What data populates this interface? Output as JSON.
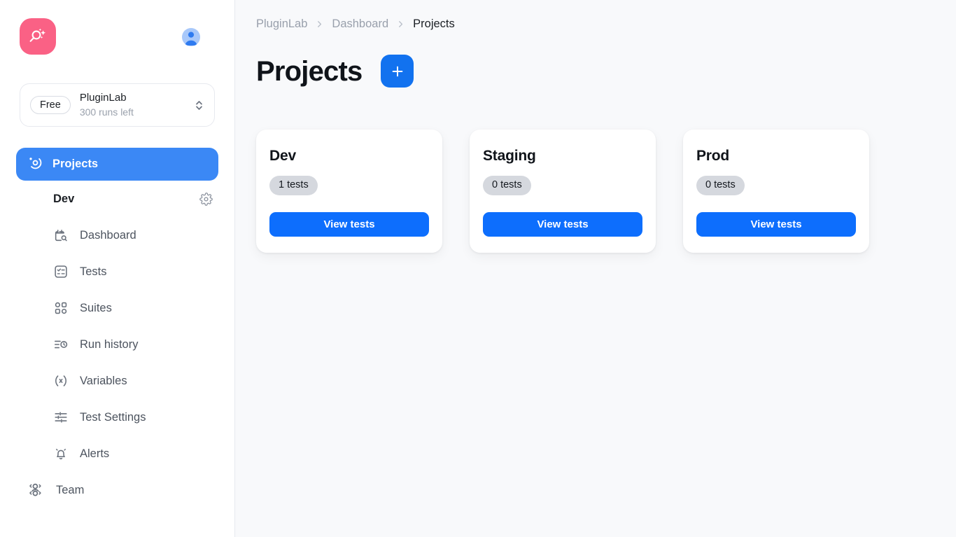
{
  "sidebar": {
    "logo_icon": "magnifier-sparkle-logo",
    "logo_color": "#fa6185",
    "avatar_icon": "user-avatar-icon",
    "workspace": {
      "plan_label": "Free",
      "name": "PluginLab",
      "runs_left": "300 runs left",
      "chevron_icon": "chevron-up-down-icon"
    },
    "primary_nav": {
      "label": "Projects",
      "icon": "orbit-icon",
      "active_color": "#3b88f5"
    },
    "project": {
      "name": "Dev",
      "settings_icon": "gear-icon"
    },
    "items": [
      {
        "label": "Dashboard",
        "icon": "calendar-search-icon"
      },
      {
        "label": "Tests",
        "icon": "checklist-square-icon"
      },
      {
        "label": "Suites",
        "icon": "grid-shapes-icon"
      },
      {
        "label": "Run history",
        "icon": "list-clock-icon"
      },
      {
        "label": "Variables",
        "icon": "variable-x-icon"
      },
      {
        "label": "Test Settings",
        "icon": "sliders-icon"
      },
      {
        "label": "Alerts",
        "icon": "bell-ring-icon"
      }
    ],
    "team": {
      "label": "Team",
      "icon": "users-group-icon"
    }
  },
  "main": {
    "breadcrumb": [
      {
        "label": "PluginLab",
        "current": false
      },
      {
        "label": "Dashboard",
        "current": false
      },
      {
        "label": "Projects",
        "current": true
      }
    ],
    "breadcrumb_separator_icon": "chevron-right-icon",
    "page_title": "Projects",
    "add_button": {
      "icon": "plus-icon",
      "color": "#1272ef"
    },
    "cards": [
      {
        "title": "Dev",
        "badge": "1 tests",
        "button_label": "View tests"
      },
      {
        "title": "Staging",
        "badge": "0 tests",
        "button_label": "View tests"
      },
      {
        "title": "Prod",
        "badge": "0 tests",
        "button_label": "View tests"
      }
    ]
  }
}
